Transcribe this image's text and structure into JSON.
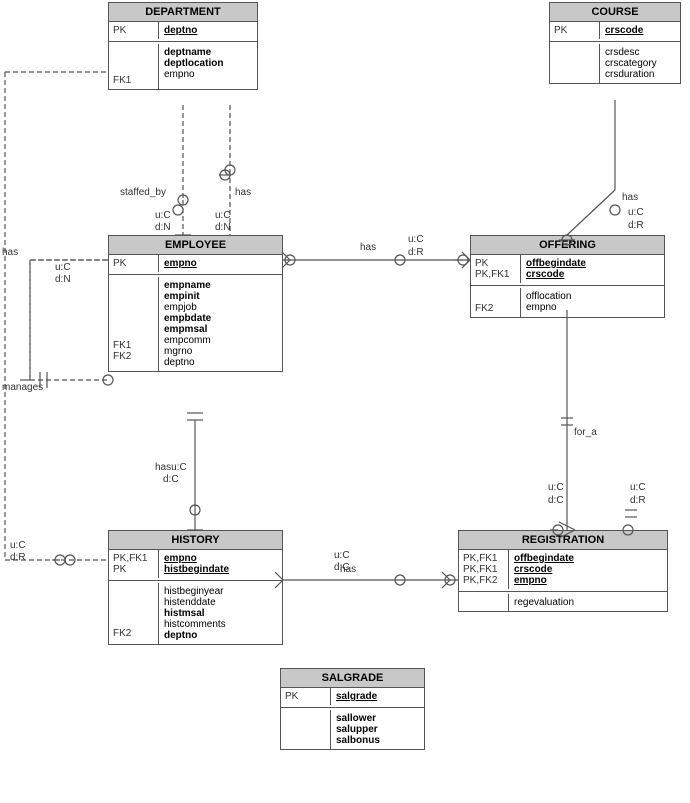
{
  "entities": {
    "course": {
      "title": "COURSE",
      "pk_labels": [
        "PK"
      ],
      "pk_attrs": [
        "crscode"
      ],
      "attrs": [
        "crsdesc",
        "crscategory",
        "crsduration"
      ]
    },
    "department": {
      "title": "DEPARTMENT",
      "pk_labels": [
        "PK"
      ],
      "pk_attrs": [
        "deptno"
      ],
      "fk_labels": [
        "FK1"
      ],
      "fk_attrs": [
        "empno"
      ],
      "attrs": [
        "deptname",
        "deptlocation",
        "empno"
      ]
    },
    "employee": {
      "title": "EMPLOYEE",
      "pk_labels": [
        "PK"
      ],
      "pk_attrs": [
        "empno"
      ],
      "attrs_bold": [
        "empname",
        "empinit"
      ],
      "attrs_normal": [
        "empjob"
      ],
      "attrs_bold2": [
        "empbdate",
        "empmsal"
      ],
      "attrs_normal2": [
        "empcomm",
        "mgrno",
        "deptno"
      ],
      "fk_labels": [
        "FK1",
        "FK2"
      ],
      "fk_attrs": [
        "mgrno",
        "deptno"
      ]
    },
    "offering": {
      "title": "OFFERING",
      "pk_labels": [
        "PK",
        "PK,FK1"
      ],
      "pk_attrs": [
        "offbegindate",
        "crscode"
      ],
      "fk_labels": [
        "FK2"
      ],
      "fk_attrs": [
        "empno"
      ],
      "attrs": [
        "offlocation",
        "empno"
      ]
    },
    "history": {
      "title": "HISTORY",
      "pk_labels": [
        "PK,FK1",
        "PK"
      ],
      "pk_attrs": [
        "empno",
        "histbegindate"
      ],
      "fk_labels": [
        "FK2"
      ],
      "fk_attrs": [
        "deptno"
      ],
      "attrs": [
        "histbeginyear",
        "histenddate",
        "histmsal",
        "histcomments",
        "deptno"
      ]
    },
    "registration": {
      "title": "REGISTRATION",
      "pk_labels": [
        "PK,FK1",
        "PK,FK1",
        "PK,FK2"
      ],
      "pk_attrs": [
        "offbegindate",
        "crscode",
        "empno"
      ],
      "attrs": [
        "regevaluation"
      ]
    },
    "salgrade": {
      "title": "SALGRADE",
      "pk_labels": [
        "PK"
      ],
      "pk_attrs": [
        "salgrade"
      ],
      "attrs": [
        "sallower",
        "salupper",
        "salbonus"
      ]
    }
  },
  "labels": {
    "staffed_by": "staffed_by",
    "has": "has",
    "manages": "manages",
    "for_a": "for_a"
  }
}
